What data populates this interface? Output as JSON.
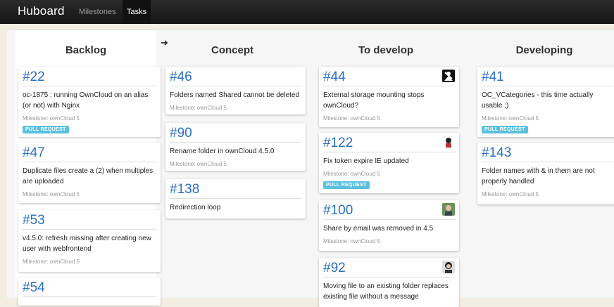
{
  "nav": {
    "brand": "Huboard",
    "links": [
      "Milestones",
      "Tasks"
    ]
  },
  "columns": [
    {
      "title": "Backlog",
      "cards": [
        {
          "number": "#22",
          "title": "oc-1875 : running OwnCloud on an alias (or not) with Nginx",
          "milestone": "Milestone: ownCloud 5",
          "badge": "PULL REQUEST"
        },
        {
          "number": "#47",
          "title": "Duplicate files create a (2) when multiples are uploaded",
          "milestone": "Milestone: ownCloud 5"
        },
        {
          "number": "#53",
          "title": "v4.5.0: refresh missing after creating new user with webfrontend",
          "milestone": "Milestone: ownCloud 5"
        },
        {
          "number": "#54"
        }
      ]
    },
    {
      "title": "Concept",
      "cards": [
        {
          "number": "#46",
          "title": "Folders named Shared cannot be deleted",
          "milestone": "Milestone: ownCloud 5"
        },
        {
          "number": "#90",
          "title": "Rename folder in ownCloud 4.5.0",
          "milestone": "Milestone: ownCloud 5"
        },
        {
          "number": "#138",
          "title": "Redirection loop"
        }
      ]
    },
    {
      "title": "To develop",
      "cards": [
        {
          "number": "#44",
          "title": "External storage mounting stops ownCloud?",
          "milestone": "Milestone: ownCloud 5",
          "avatar": "avatar-icon"
        },
        {
          "number": "#122",
          "title": "Fix token expire IE updated",
          "milestone": "Milestone: ownCloud 5",
          "badge": "PULL REQUEST",
          "avatar": "avatar-icon"
        },
        {
          "number": "#100",
          "title": "Share by email was removed in 4.5",
          "milestone": "Milestone: ownCloud 5",
          "avatar": "avatar-icon"
        },
        {
          "number": "#92",
          "title": "Moving file to an existing folder replaces existing file without a message",
          "avatar": "avatar-icon"
        }
      ]
    },
    {
      "title": "Developing",
      "cards": [
        {
          "number": "#41",
          "title": "OC_VCategories - this time actually usable ;)",
          "milestone": "Milestone: ownCloud 5",
          "badge": "PULL REQUEST"
        },
        {
          "number": "#143",
          "title": "Folder names with & in them are not properly handled",
          "milestone": "Milestone: ownCloud 5"
        }
      ]
    }
  ],
  "colors": {
    "navbar": "#1c1c1c",
    "link": "#2a6fc4",
    "badge": "#5bc0de",
    "background": "#f3ede2"
  },
  "icons": {
    "column_move": "arrow-right-icon"
  }
}
